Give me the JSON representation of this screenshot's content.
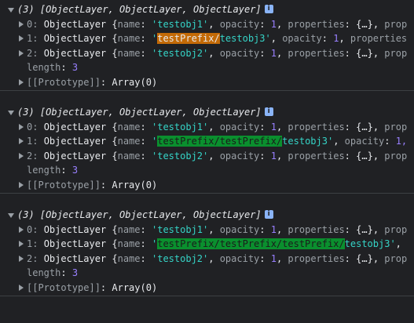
{
  "colors": {
    "background": "#202124",
    "divider": "#3c4043",
    "string": "#35d4c7",
    "number": "#9980ff",
    "muted": "#9aa0a6",
    "highlight_orange": "#c36a06",
    "highlight_green": "#0a8f2e",
    "info_badge": "#8ab4f8"
  },
  "icons": {
    "expanded": "triangle-down-icon",
    "collapsed": "triangle-right-icon",
    "info": "info-icon"
  },
  "info_badge_text": "i",
  "punct": {
    "colon_space": ": ",
    "item_prefix": " {",
    "name_key": "name",
    "q": "'",
    "comma_sp": ", ",
    "opacity_key": "opacity",
    "properties_key": "properties",
    "ellipsis_obj": "{…}",
    "trailing_prop": "prop",
    "trailing_properties": "properties",
    "trailing_one_comma": "1,",
    "open_brace": "{",
    "close_brace": "}"
  },
  "logs": [
    {
      "header": "(3) [ObjectLayer, ObjectLayer, ObjectLayer]",
      "items": [
        {
          "index": "0",
          "type": "ObjectLayer",
          "highlight": "",
          "rest": "testobj1",
          "opacity": "1",
          "trailing": "prop"
        },
        {
          "index": "1",
          "type": "ObjectLayer",
          "highlight": "testPrefix/",
          "rest": "testobj3",
          "opacity": "1",
          "trailing": "properties"
        },
        {
          "index": "2",
          "type": "ObjectLayer",
          "highlight": "",
          "rest": "testobj2",
          "opacity": "1",
          "trailing": "prop"
        }
      ],
      "length_label": "length",
      "length_value": "3",
      "prototype_label": "[[Prototype]]",
      "prototype_value": "Array(0)"
    },
    {
      "header": "(3) [ObjectLayer, ObjectLayer, ObjectLayer]",
      "items": [
        {
          "index": "0",
          "type": "ObjectLayer",
          "highlight": "",
          "rest": "testobj1",
          "opacity": "1",
          "trailing": "prop"
        },
        {
          "index": "1",
          "type": "ObjectLayer",
          "highlight": "testPrefix/testPrefix/",
          "rest": "testobj3",
          "opacity": "1,",
          "trailing": ""
        },
        {
          "index": "2",
          "type": "ObjectLayer",
          "highlight": "",
          "rest": "testobj2",
          "opacity": "1",
          "trailing": "prop"
        }
      ],
      "length_label": "length",
      "length_value": "3",
      "prototype_label": "[[Prototype]]",
      "prototype_value": "Array(0)"
    },
    {
      "header": "(3) [ObjectLayer, ObjectLayer, ObjectLayer]",
      "items": [
        {
          "index": "0",
          "type": "ObjectLayer",
          "highlight": "",
          "rest": "testobj1",
          "opacity": "1",
          "trailing": "prop"
        },
        {
          "index": "1",
          "type": "ObjectLayer",
          "highlight": "testPrefix/testPrefix/testPrefix/",
          "rest": "testobj3",
          "opacity": "",
          "trailing": ""
        },
        {
          "index": "2",
          "type": "ObjectLayer",
          "highlight": "",
          "rest": "testobj2",
          "opacity": "1",
          "trailing": "prop"
        }
      ],
      "length_label": "length",
      "length_value": "3",
      "prototype_label": "[[Prototype]]",
      "prototype_value": "Array(0)"
    }
  ]
}
